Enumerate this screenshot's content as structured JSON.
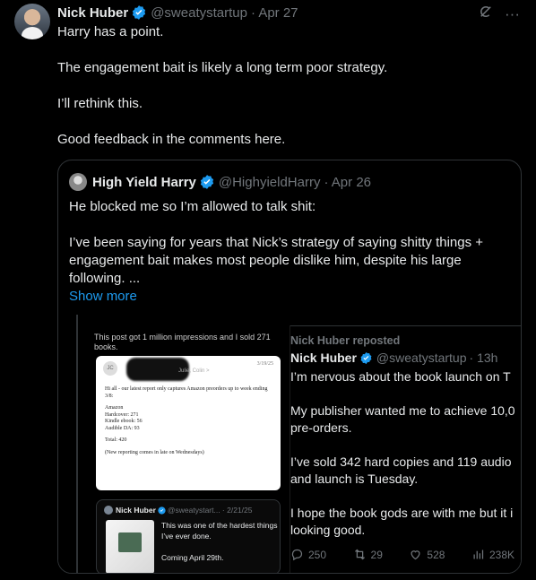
{
  "tweet": {
    "author_name": "Nick Huber",
    "handle": "@sweatystartup",
    "date": "· Apr 27",
    "lines": [
      "Harry has a point.",
      "The engagement bait is likely a long term poor strategy.",
      "I’ll rethink this.",
      "Good feedback in the comments here."
    ]
  },
  "quote": {
    "author_name": "High Yield Harry",
    "handle": "@HighyieldHarry",
    "date": "· Apr 26",
    "lines": [
      "He blocked me so I’m allowed to talk shit:",
      "I’ve been saying for years that Nick’s strategy of saying shitty things + engagement bait makes most people dislike him, despite his large following. ..."
    ],
    "show_more": "Show more"
  },
  "image": {
    "inner_post_text": "This post got 1 million impressions and I sold 271 books.",
    "email": {
      "avatar_initials": "JC",
      "recipient": "Julie, Colin >",
      "date": "3/19/25",
      "greeting": "Hi all - our latest report only captures Amazon preorders up to week ending 3/8:",
      "lines": [
        "Amazon",
        "Hardcover: 271",
        "Kindle ebook: 56",
        "Audible DA: 93"
      ],
      "total": "Total: 420",
      "note": "(New reporting comes in late on Wednesdays)"
    },
    "mini_card": {
      "name": "Nick Huber",
      "handle_date": "@sweatystart... · 2/21/25",
      "text": "This was one of the hardest things I’ve ever done.",
      "coming": "Coming April 29th."
    },
    "repost": {
      "label": "Nick Huber reposted",
      "name": "Nick Huber",
      "handle": "@sweatystartup",
      "time": "· 13h",
      "lines": [
        "I’m nervous about the book launch on T",
        "My publisher wanted me to achieve 10,0 pre-orders.",
        "I’ve sold 342 hard copies and 119 audio and launch is Tuesday.",
        "I hope the book gods are with me but it i looking good."
      ],
      "stats": {
        "replies": "250",
        "reposts": "29",
        "likes": "528",
        "views": "238K"
      }
    }
  },
  "colors": {
    "accent": "#1d9bf0",
    "muted": "#71767b",
    "text": "#e7e9ea",
    "background": "#000000"
  }
}
